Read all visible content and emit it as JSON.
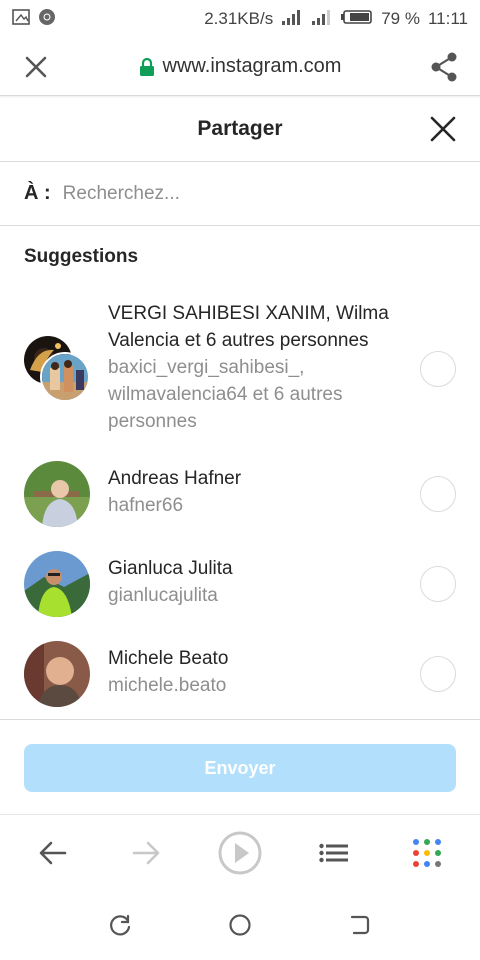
{
  "status_bar": {
    "speed": "2.31KB/s",
    "battery": "79 %",
    "time": "11:11"
  },
  "browser": {
    "url": "www.instagram.com"
  },
  "share": {
    "title": "Partager",
    "to_label": "À :",
    "search_placeholder": "Recherchez...",
    "suggestions_title": "Suggestions",
    "send_label": "Envoyer"
  },
  "suggestions": [
    {
      "name": "VERGI SAHIBESI XANIM, Wilma Valencia et 6 autres personnes",
      "username": "baxici_vergi_sahibesi_, wilmavalencia64 et 6 autres personnes"
    },
    {
      "name": "Andreas Hafner",
      "username": "hafner66"
    },
    {
      "name": "Gianluca Julita",
      "username": "gianlucajulita"
    },
    {
      "name": "Michele Beato",
      "username": "michele.beato"
    }
  ],
  "colors": {
    "send_disabled": "#b2dffc",
    "lock": "#0f9d58",
    "radio_border": "#dbdbdb"
  }
}
